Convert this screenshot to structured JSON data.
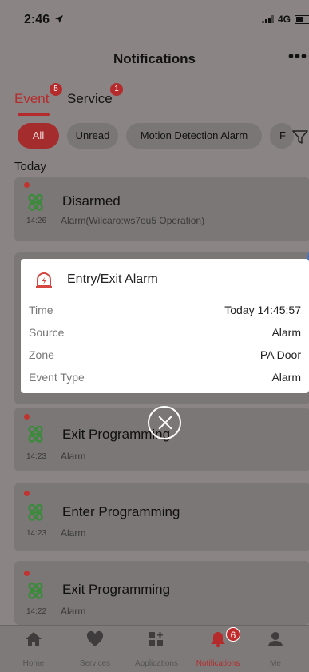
{
  "status_bar": {
    "time": "2:46",
    "network": "4G"
  },
  "header": {
    "title": "Notifications"
  },
  "tabs": [
    {
      "label": "Event",
      "badge": "5",
      "active": true
    },
    {
      "label": "Service",
      "badge": "1",
      "active": false
    }
  ],
  "filters": [
    {
      "label": "All",
      "active": true
    },
    {
      "label": "Unread",
      "active": false
    },
    {
      "label": "Motion Detection Alarm",
      "active": false
    },
    {
      "label": "F",
      "active": false
    }
  ],
  "section_label": "Today",
  "events": [
    {
      "title": "Disarmed",
      "time": "14:26",
      "desc": "Alarm(Wilcaro:ws7ou5 Operation)",
      "unread": true
    },
    {
      "title": "Exit Programming",
      "time": "14:23",
      "desc": "Alarm",
      "unread": true
    },
    {
      "title": "Enter Programming",
      "time": "14:23",
      "desc": "Alarm",
      "unread": true
    },
    {
      "title": "Exit Programming",
      "time": "14:22",
      "desc": "Alarm",
      "unread": true
    }
  ],
  "modal": {
    "title": "Entry/Exit Alarm",
    "rows": [
      {
        "label": "Time",
        "value": "Today 14:45:57"
      },
      {
        "label": "Source",
        "value": "Alarm"
      },
      {
        "label": "Zone",
        "value": "PA Door"
      },
      {
        "label": "Event Type",
        "value": "Alarm"
      }
    ]
  },
  "bottom_nav": [
    {
      "label": "Home",
      "icon": "home-icon",
      "active": false
    },
    {
      "label": "Services",
      "icon": "heart-icon",
      "active": false
    },
    {
      "label": "Applications",
      "icon": "apps-icon",
      "active": false
    },
    {
      "label": "Notifications",
      "icon": "bell-icon",
      "active": true,
      "badge": "6"
    },
    {
      "label": "Me",
      "icon": "person-icon",
      "active": false
    }
  ],
  "colors": {
    "accent": "#b52b2b",
    "icon_green": "#3c8a3c",
    "overlay": "#8a8584",
    "arrow_blue": "#4a73b8"
  }
}
